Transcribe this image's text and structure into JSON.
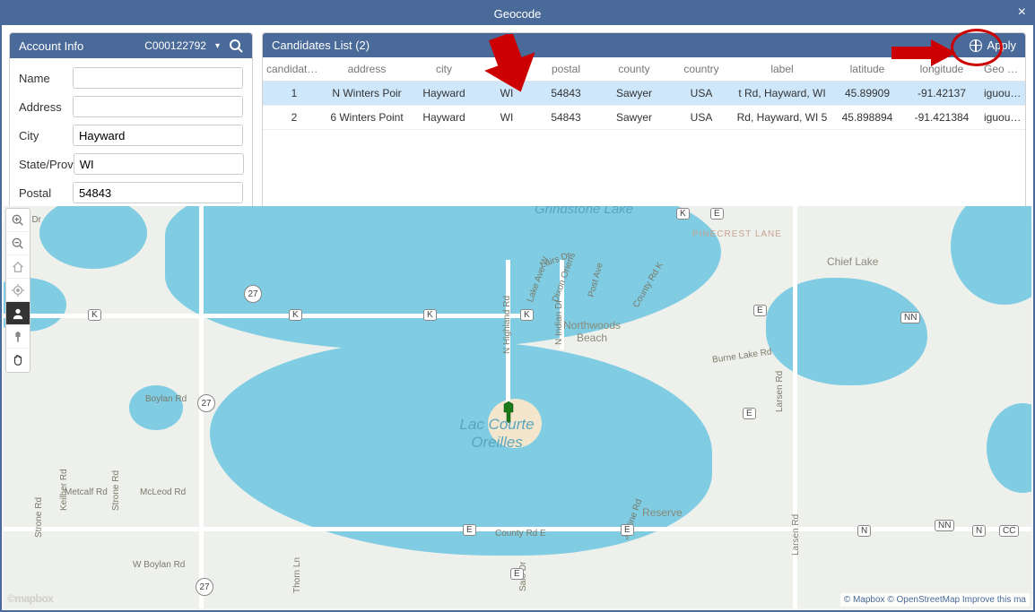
{
  "window": {
    "title": "Geocode"
  },
  "account": {
    "header": "Account Info",
    "id": "C000122792",
    "fields": {
      "name_label": "Name",
      "name_value": "",
      "address_label": "Address",
      "address_value": "",
      "city_label": "City",
      "city_value": "Hayward",
      "state_label": "State/Prov",
      "state_value": "WI",
      "postal_label": "Postal",
      "postal_value": "54843"
    }
  },
  "candidates": {
    "header": "Candidates List (2)",
    "apply_label": "Apply",
    "columns": [
      "candidateN...",
      "address",
      "city",
      "sta...",
      "postal",
      "county",
      "country",
      "label",
      "latitude",
      "longitude",
      "Geo Result"
    ],
    "rows": [
      {
        "num": "1",
        "address": "N Winters Poir",
        "city": "Hayward",
        "state": "WI",
        "postal": "54843",
        "county": "Sawyer",
        "country": "USA",
        "label": "t Rd, Hayward, WI",
        "lat": "45.89909",
        "lng": "-91.42137",
        "result": "iguous houseNum",
        "selected": true
      },
      {
        "num": "2",
        "address": "6 Winters Point",
        "city": "Hayward",
        "state": "WI",
        "postal": "54843",
        "county": "Sawyer",
        "country": "USA",
        "label": "Rd, Hayward, WI 5",
        "lat": "45.898894",
        "lng": "-91.421384",
        "result": "iguous houseNum",
        "selected": false
      }
    ]
  },
  "map": {
    "labels": {
      "grindstone": "Grindstone Lake",
      "lac_courte": "Lac Courte Oreilles",
      "northwoods": "Northwoods Beach",
      "chief_lake": "Chief Lake",
      "pinecrest": "PINECREST LANE",
      "reserve": "Reserve"
    },
    "roads": {
      "boylan": "Boylan Rd",
      "wboylan": "W Boylan Rd",
      "metcalf": "Metcalf Rd",
      "mcleod": "McLeod Rd",
      "keilher": "Keilher Rd",
      "ood": "ood Dr",
      "highland": "N Highland Rd",
      "indian": "N Indian Dr",
      "lakeave": "Lake Ave W",
      "dixon": "Dixon Oriens",
      "postave": "Post Ave",
      "countyrdk": "County Rd K",
      "burnelake": "Burne Lake Rd",
      "larsen": "Larsen Rd",
      "thorn": "Thorn Ln",
      "salobr": "Salo Dr",
      "countyrde": "County Rd E",
      "strone": "Strone Rd",
      "lairs": "Lairs Dr",
      "jostine": "Jostine Rd"
    },
    "shields": {
      "hwy27": "27",
      "K": "K",
      "E": "E",
      "NN": "NN",
      "CC": "CC",
      "N": "N"
    },
    "attribution": {
      "mapbox": "© Mapbox",
      "osm": "© OpenStreetMap",
      "improve": "Improve this ma"
    },
    "logo": "©mapbox"
  }
}
